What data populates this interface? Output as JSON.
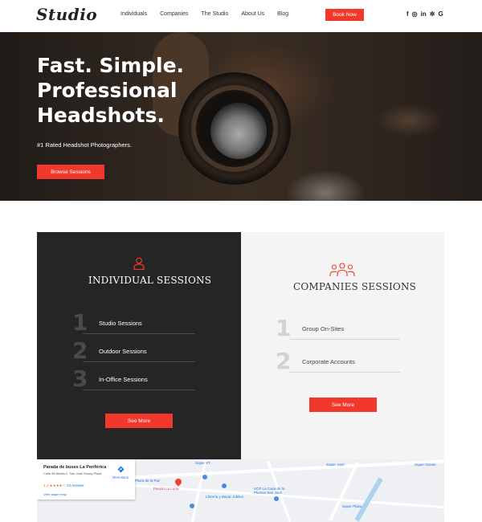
{
  "nav": {
    "logo": "Studio",
    "links": [
      "Individuals",
      "Companies",
      "The Studio",
      "About Us",
      "Blog"
    ],
    "book_label": "Book Now",
    "social": [
      {
        "icon": "facebook-icon",
        "glyph": "f"
      },
      {
        "icon": "instagram-icon",
        "glyph": "◎"
      },
      {
        "icon": "linkedin-icon",
        "glyph": "in"
      },
      {
        "icon": "yelp-icon",
        "glyph": "✲"
      },
      {
        "icon": "google-icon",
        "glyph": "G"
      }
    ]
  },
  "hero": {
    "title_line1": "Fast. Simple.",
    "title_line2": "Professional",
    "title_line3": "Headshots.",
    "subtitle": "#1 Rated Headshot Photographers.",
    "button_label": "Browse Sessions"
  },
  "individual": {
    "title": "INDIVIDUAL SESSIONS",
    "items": [
      {
        "num": "1",
        "label": "Studio Sessions"
      },
      {
        "num": "2",
        "label": "Outdoor Sessions"
      },
      {
        "num": "3",
        "label": "In-Office Sessions"
      }
    ],
    "button_label": "See More"
  },
  "companies": {
    "title": "COMPANIES SESSIONS",
    "items": [
      {
        "num": "1",
        "label": "Group On-Sites"
      },
      {
        "num": "2",
        "label": "Corporate Accounts"
      }
    ],
    "button_label": "See More"
  },
  "map": {
    "place_name": "Parada de buses La Periférica",
    "address": "Calle 56 Abella 2, San José Sonny Plaza",
    "rating": "4.4",
    "stars": "★★★★☆",
    "reviews": "13 reviews",
    "directions": "Directions",
    "larger_map": "View larger map",
    "labels": [
      {
        "text": "Super XT",
        "color": "blue"
      },
      {
        "text": "Plaza de la Paz",
        "color": "blue"
      },
      {
        "text": "Pasión La Luna",
        "color": "red"
      },
      {
        "text": "Librería y Bazar Jubileo",
        "color": "blue"
      },
      {
        "text": "UCP La Casa de la Plumas San José",
        "color": "blue"
      },
      {
        "text": "Super Plaza",
        "color": "blue"
      },
      {
        "text": "Super Jose",
        "color": "blue"
      },
      {
        "text": "Super Ocean",
        "color": "blue"
      }
    ]
  },
  "colors": {
    "accent": "#f2372b",
    "dark_panel": "#252525",
    "light_panel": "#f4f4f4"
  }
}
